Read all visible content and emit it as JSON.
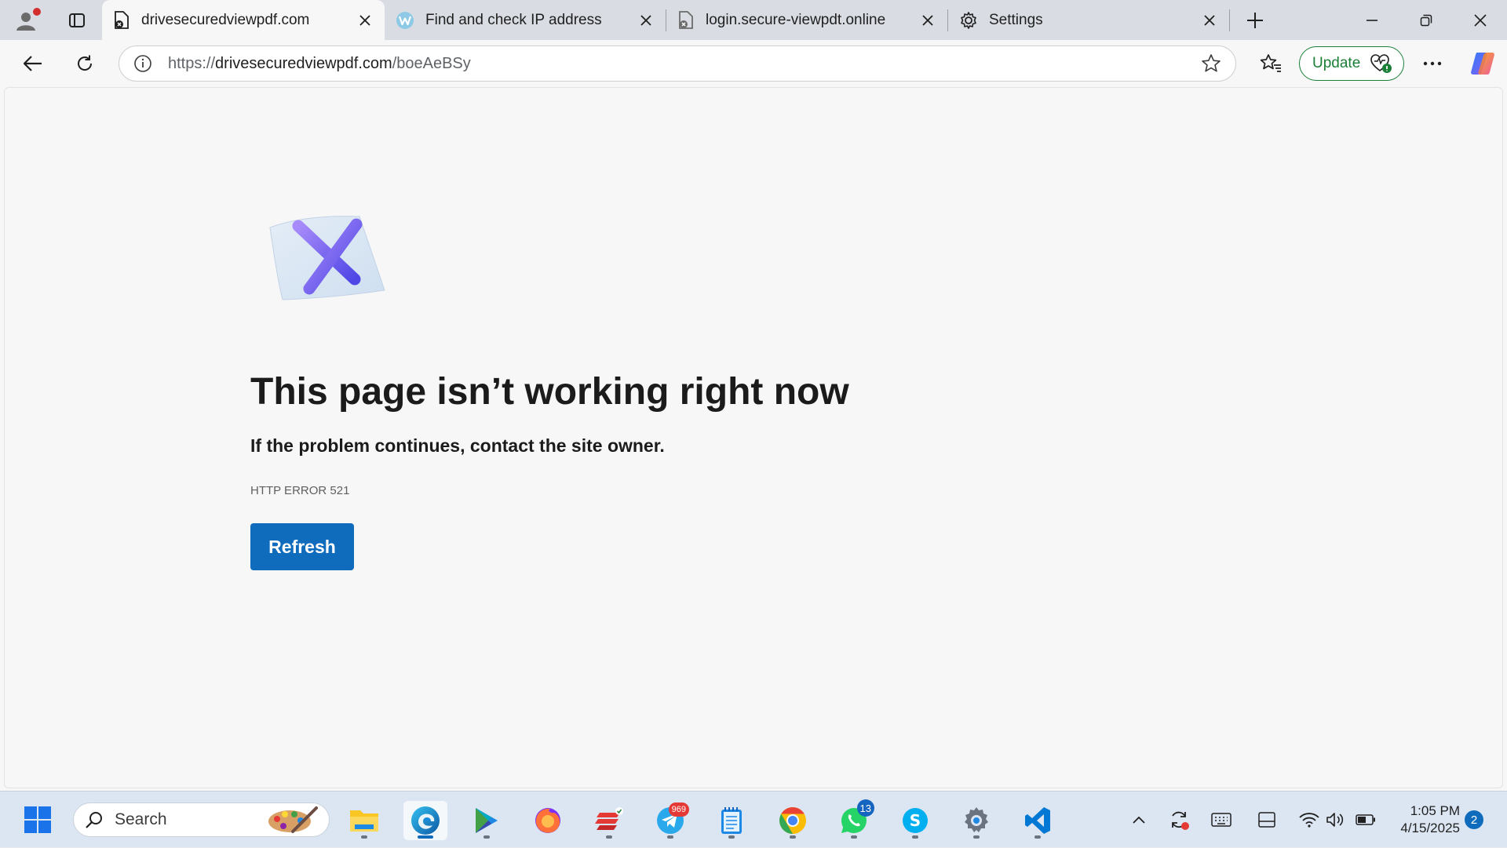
{
  "tabs": [
    {
      "title": "drivesecuredviewpdf.com",
      "active": true,
      "icon": "broken-page-icon"
    },
    {
      "title": "Find and check IP address",
      "active": false,
      "icon": "w-logo-icon"
    },
    {
      "title": "login.secure-viewpdt.online",
      "active": false,
      "icon": "broken-page-icon"
    },
    {
      "title": "Settings",
      "active": false,
      "icon": "gear-icon"
    }
  ],
  "address": {
    "scheme": "https://",
    "host": "drivesecuredviewpdf.com",
    "path": "/boeAeBSy"
  },
  "toolbar": {
    "update_label": "Update"
  },
  "error": {
    "title": "This page isn’t working right now",
    "subtitle": "If the problem continues, contact the site owner.",
    "code": "HTTP ERROR 521",
    "refresh_label": "Refresh"
  },
  "taskbar": {
    "search_placeholder": "Search",
    "badges": {
      "telegram": "969",
      "whatsapp": "13"
    },
    "time": "1:05 PM",
    "date": "4/15/2025",
    "notifications": "2"
  },
  "colors": {
    "accent": "#0f6cbd",
    "update_green": "#1a7f37",
    "badge_red": "#e53935"
  }
}
